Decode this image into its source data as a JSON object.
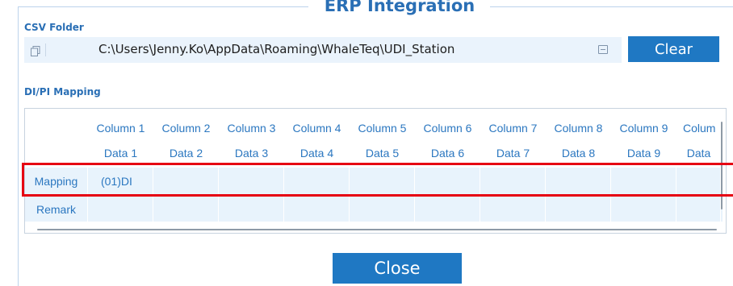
{
  "dialog": {
    "title": "ERP Integration"
  },
  "csv_folder": {
    "label": "CSV Folder",
    "path": "C:\\Users\\Jenny.Ko\\AppData\\Roaming\\WhaleTeq\\UDI_Station",
    "clear_label": "Clear"
  },
  "mapping": {
    "label": "DI/PI Mapping",
    "columns": [
      "Column 1",
      "Column 2",
      "Column 3",
      "Column 4",
      "Column 5",
      "Column 6",
      "Column 7",
      "Column 8",
      "Column 9",
      "Colum"
    ],
    "data": [
      "Data 1",
      "Data 2",
      "Data 3",
      "Data 4",
      "Data 5",
      "Data 6",
      "Data 7",
      "Data 8",
      "Data 9",
      "Data"
    ],
    "rows": [
      {
        "label": "Mapping",
        "values": [
          "(01)DI",
          "",
          "",
          "",
          "",
          "",
          "",
          "",
          "",
          ""
        ]
      },
      {
        "label": "Remark",
        "values": [
          "",
          "",
          "",
          "",
          "",
          "",
          "",
          "",
          "",
          ""
        ]
      }
    ]
  },
  "footer": {
    "close_label": "Close"
  },
  "colors": {
    "accent": "#1f78c3",
    "highlight": "#e60012",
    "row_fill": "#e8f3fc"
  }
}
